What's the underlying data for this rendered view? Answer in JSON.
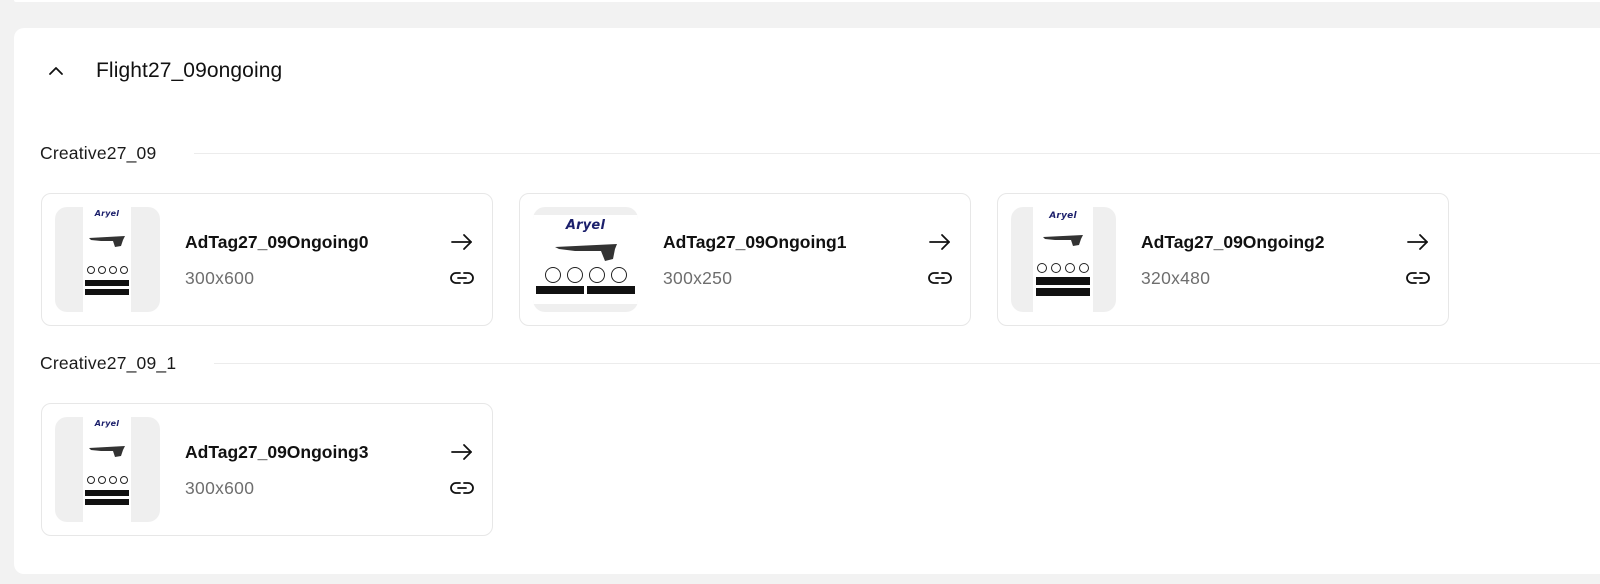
{
  "flight": {
    "title": "Flight27_09ongoing",
    "expanded": true,
    "toggle_icon": "chevron-up-icon"
  },
  "creatives": [
    {
      "label": "Creative27_09",
      "ad_tags": [
        {
          "name": "AdTag27_09Ongoing0",
          "size": "300x600",
          "thumb_format": "tall"
        },
        {
          "name": "AdTag27_09Ongoing1",
          "size": "300x250",
          "thumb_format": "wide"
        },
        {
          "name": "AdTag27_09Ongoing2",
          "size": "320x480",
          "thumb_format": "tall"
        }
      ]
    },
    {
      "label": "Creative27_09_1",
      "ad_tags": [
        {
          "name": "AdTag27_09Ongoing3",
          "size": "300x600",
          "thumb_format": "tall"
        }
      ]
    }
  ],
  "thumbnail": {
    "logo_text": "Aryel",
    "logo_color": "#1b1f6b"
  },
  "icons": {
    "open": "arrow-right-icon",
    "copy_link": "link-icon"
  },
  "colors": {
    "page_bg": "#f2f2f2",
    "panel_bg": "#ffffff",
    "card_border": "#e7e7e7",
    "muted_text": "#6e6e6e"
  }
}
